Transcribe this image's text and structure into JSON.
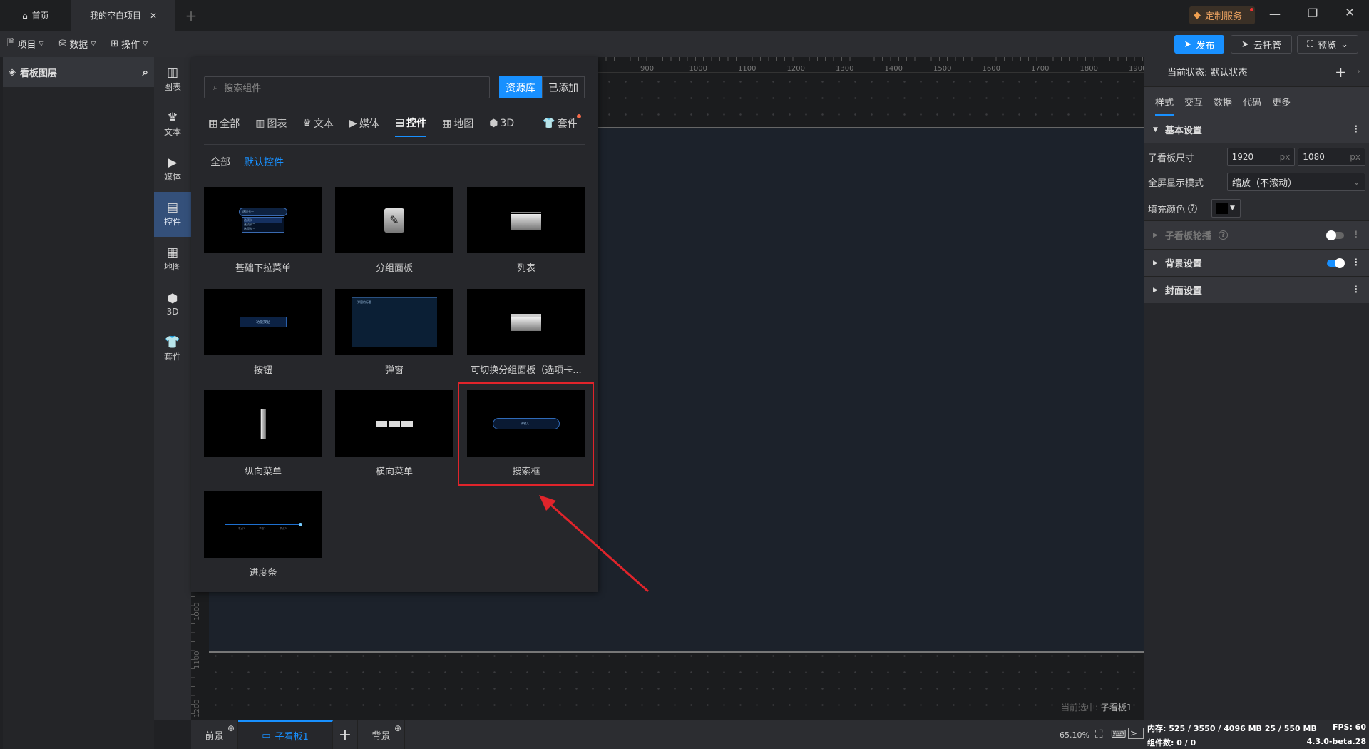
{
  "titlebar": {
    "home_tab": "首页",
    "project_tab": "我的空白项目",
    "custom_service": "定制服务"
  },
  "toolbar": {
    "project": "项目",
    "data": "数据",
    "operate": "操作",
    "publish": "发布",
    "cloud": "云托管",
    "preview": "预览"
  },
  "layers": {
    "title": "看板图层"
  },
  "iconbar": [
    {
      "label": "图表",
      "icon": "chart-icon"
    },
    {
      "label": "文本",
      "icon": "crown-icon"
    },
    {
      "label": "媒体",
      "icon": "camera-icon"
    },
    {
      "label": "控件",
      "icon": "widget-icon",
      "active": true
    },
    {
      "label": "地图",
      "icon": "map-icon"
    },
    {
      "label": "3D",
      "icon": "cube-icon"
    },
    {
      "label": "套件",
      "icon": "shirt-icon"
    }
  ],
  "panel": {
    "search_placeholder": "搜索组件",
    "library": "资源库",
    "added": "已添加",
    "categories": [
      "全部",
      "图表",
      "文本",
      "媒体",
      "控件",
      "地图",
      "3D",
      "套件"
    ],
    "active_category": "控件",
    "filters": [
      "全部",
      "默认控件"
    ],
    "components": [
      "基础下拉菜单",
      "分组面板",
      "列表",
      "按钮",
      "弹窗",
      "可切换分组面板（选项卡...",
      "纵向菜单",
      "横向菜单",
      "搜索框",
      "进度条"
    ],
    "highlighted": "搜索框",
    "thumb_text": {
      "dropdown": [
        "选项卡一",
        "选项卡一",
        "选项卡二",
        "选项卡三"
      ],
      "button": "功能按钮",
      "dialog": "弹窗的标题",
      "search": "请输入...",
      "progress": [
        "节点1",
        "节点2",
        "节点3"
      ]
    }
  },
  "ruler": {
    "h": [
      "900",
      "1000",
      "1100",
      "1200",
      "1300",
      "1400",
      "1500",
      "1600",
      "1700",
      "1800",
      "1900"
    ],
    "v": [
      "1000",
      "1100",
      "1200"
    ]
  },
  "canvas": {
    "selected_label": "当前选中:",
    "selected_value": "子看板1"
  },
  "bottom": {
    "foreground": "前景",
    "board": "子看板1",
    "background": "背景",
    "zoom": "65.10%"
  },
  "status": {
    "memory": "内存: 525 / 3550 / 4096 MB  25 / 550 MB",
    "fps": "FPS: 60",
    "components": "组件数: 0 / 0",
    "version": "4.3.0-beta.28"
  },
  "right": {
    "state": "当前状态:  默认状态",
    "tabs": [
      "样式",
      "交互",
      "数据",
      "代码",
      "更多"
    ],
    "basic": "基本设置",
    "size_label": "子看板尺寸",
    "width": "1920",
    "height": "1080",
    "unit": "px",
    "fullscreen_label": "全屏显示模式",
    "fullscreen_value": "缩放（不滚动）",
    "fill_label": "填充颜色",
    "fill_color": "#000000",
    "carousel": "子看板轮播",
    "carousel_on": false,
    "bg": "背景设置",
    "bg_on": true,
    "cover": "封面设置"
  },
  "colors": {
    "accent": "#1890ff",
    "highlight": "#e0242b"
  }
}
